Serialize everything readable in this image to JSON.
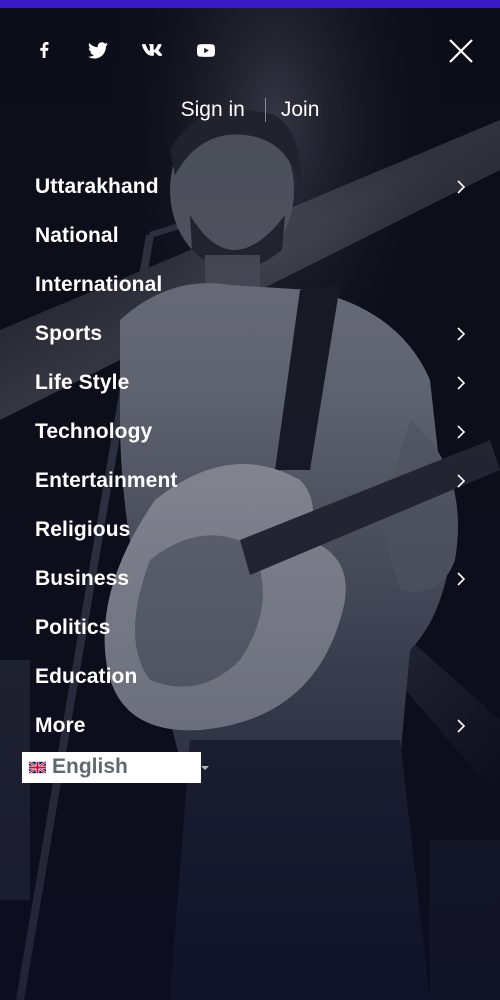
{
  "colors": {
    "accent_bar": "#3a1ac4",
    "text": "#ffffff",
    "lang_text": "#5f6a70",
    "background": "#0b0d16"
  },
  "social": [
    {
      "name": "facebook",
      "icon": "facebook-icon"
    },
    {
      "name": "twitter",
      "icon": "twitter-icon"
    },
    {
      "name": "vk",
      "icon": "vk-icon"
    },
    {
      "name": "youtube",
      "icon": "youtube-icon"
    }
  ],
  "close": {
    "icon": "close-icon"
  },
  "auth": {
    "sign_in": "Sign in",
    "join": "Join"
  },
  "menu": {
    "items": [
      {
        "label": "Uttarakhand",
        "has_children": true
      },
      {
        "label": "National",
        "has_children": false
      },
      {
        "label": "International",
        "has_children": false
      },
      {
        "label": "Sports",
        "has_children": true
      },
      {
        "label": "Life Style",
        "has_children": true
      },
      {
        "label": "Technology",
        "has_children": true
      },
      {
        "label": "Entertainment",
        "has_children": true
      },
      {
        "label": "Religious",
        "has_children": false
      },
      {
        "label": "Business",
        "has_children": true
      },
      {
        "label": "Politics",
        "has_children": false
      },
      {
        "label": "Education",
        "has_children": false
      },
      {
        "label": "More",
        "has_children": true
      }
    ]
  },
  "language": {
    "selected": "English",
    "flag_icon": "uk-flag-icon",
    "caret_icon": "caret-down-icon"
  }
}
